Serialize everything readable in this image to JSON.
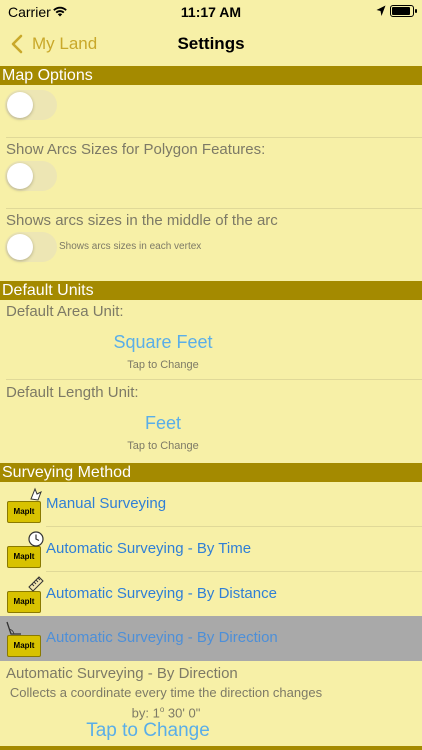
{
  "status": {
    "carrier": "Carrier",
    "time": "11:17 AM"
  },
  "nav": {
    "back_label": "My Land",
    "title": "Settings"
  },
  "map_options": {
    "header": "Map Options",
    "toggle1_on": false,
    "arcs_label": "Show Arcs Sizes for Polygon Features:",
    "arcs_on": false,
    "arcs_middle_label": "Shows arcs sizes in the middle of the arc",
    "arcs_vertex_on": false,
    "arcs_vertex_note": "Shows arcs sizes in each vertex"
  },
  "default_units": {
    "header": "Default Units",
    "area_label": "Default Area Unit:",
    "area_value": "Square Feet",
    "area_hint": "Tap to Change",
    "length_label": "Default Length Unit:",
    "length_value": "Feet",
    "length_hint": "Tap to Change"
  },
  "surveying": {
    "header": "Surveying Method",
    "badge": "MapIt",
    "methods": [
      {
        "label": "Manual Surveying",
        "icon": "hand-pointer-icon",
        "selected": false
      },
      {
        "label": "Automatic Surveying - By Time",
        "icon": "clock-icon",
        "selected": false
      },
      {
        "label": "Automatic Surveying - By Distance",
        "icon": "ruler-icon",
        "selected": false
      },
      {
        "label": "Automatic Surveying - By Direction",
        "icon": "angle-icon",
        "selected": true
      }
    ],
    "detail_title": "Automatic Surveying - By Direction",
    "detail_desc": "Collects a coordinate every time the direction changes",
    "detail_by_prefix": "by: 1",
    "detail_by_degree": "o",
    "detail_by_rest": " 30' 0\"",
    "detail_tap": "Tap to Change"
  },
  "colors": {
    "background": "#f7f0a7",
    "section_header": "#a48a00",
    "accent_back": "#c9a82a",
    "link_blue": "#2f7fd6",
    "value_blue": "#5aaee8",
    "selected_row": "#a9a9a9"
  }
}
